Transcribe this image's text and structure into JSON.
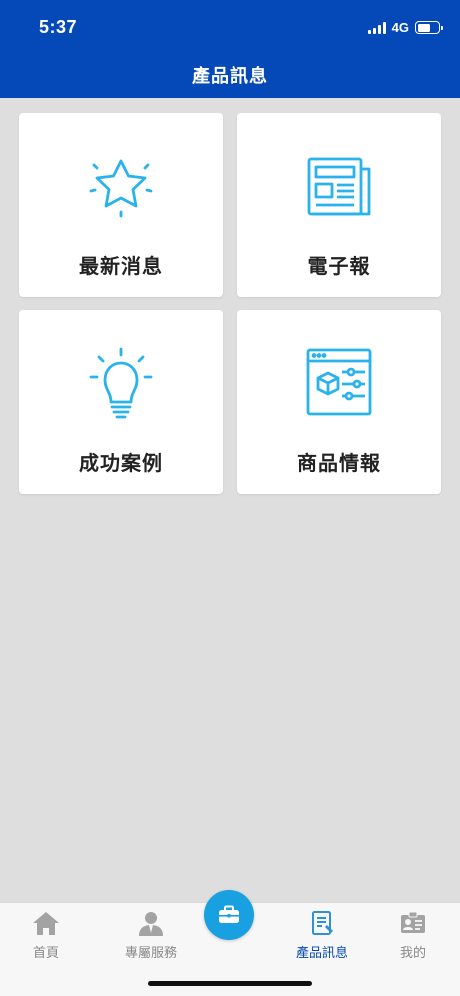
{
  "status": {
    "time": "5:37",
    "network": "4G"
  },
  "header": {
    "title": "產品訊息"
  },
  "cards": [
    {
      "label": "最新消息",
      "icon": "star-icon"
    },
    {
      "label": "電子報",
      "icon": "newspaper-icon"
    },
    {
      "label": "成功案例",
      "icon": "lightbulb-icon"
    },
    {
      "label": "商品情報",
      "icon": "product-settings-icon"
    }
  ],
  "tabs": [
    {
      "label": "首頁",
      "icon": "home-icon",
      "active": false
    },
    {
      "label": "專屬服務",
      "icon": "agent-icon",
      "active": false
    },
    {
      "label": "產品訊息",
      "icon": "document-icon",
      "active": true
    },
    {
      "label": "我的",
      "icon": "id-card-icon",
      "active": false
    }
  ],
  "center_button": {
    "icon": "briefcase-icon"
  },
  "colors": {
    "header": "#0449b7",
    "accent_icon": "#29b3ea",
    "center_button": "#18a0e0",
    "tab_inactive": "#888888"
  }
}
